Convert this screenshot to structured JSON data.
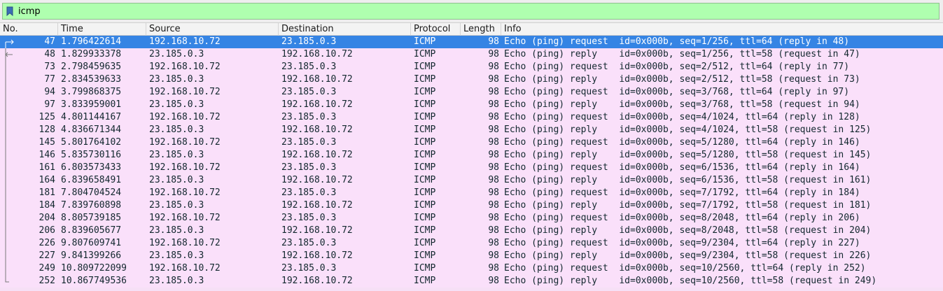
{
  "filter": {
    "value": "icmp"
  },
  "columns": [
    "No.",
    "Time",
    "Source",
    "Destination",
    "Protocol",
    "Length",
    "Info"
  ],
  "colors": {
    "row_bg": "#fae0fa",
    "selected_bg": "#3584e4",
    "filter_bg": "#afffaf"
  },
  "packets": [
    {
      "no": "47",
      "time": "1.796422614",
      "src": "192.168.10.72",
      "dst": "23.185.0.3",
      "proto": "ICMP",
      "len": "98",
      "info": "Echo (ping) request  id=0x000b, seq=1/256, ttl=64 (reply in 48)",
      "selected": true,
      "rel": "request"
    },
    {
      "no": "48",
      "time": "1.829933378",
      "src": "23.185.0.3",
      "dst": "192.168.10.72",
      "proto": "ICMP",
      "len": "98",
      "info": "Echo (ping) reply    id=0x000b, seq=1/256, ttl=58 (request in 47)",
      "selected": false,
      "rel": "reply"
    },
    {
      "no": "73",
      "time": "2.798459635",
      "src": "192.168.10.72",
      "dst": "23.185.0.3",
      "proto": "ICMP",
      "len": "98",
      "info": "Echo (ping) request  id=0x000b, seq=2/512, ttl=64 (reply in 77)",
      "selected": false,
      "rel": "line"
    },
    {
      "no": "77",
      "time": "2.834539633",
      "src": "23.185.0.3",
      "dst": "192.168.10.72",
      "proto": "ICMP",
      "len": "98",
      "info": "Echo (ping) reply    id=0x000b, seq=2/512, ttl=58 (request in 73)",
      "selected": false,
      "rel": "line"
    },
    {
      "no": "94",
      "time": "3.799868375",
      "src": "192.168.10.72",
      "dst": "23.185.0.3",
      "proto": "ICMP",
      "len": "98",
      "info": "Echo (ping) request  id=0x000b, seq=3/768, ttl=64 (reply in 97)",
      "selected": false,
      "rel": "line"
    },
    {
      "no": "97",
      "time": "3.833959001",
      "src": "23.185.0.3",
      "dst": "192.168.10.72",
      "proto": "ICMP",
      "len": "98",
      "info": "Echo (ping) reply    id=0x000b, seq=3/768, ttl=58 (request in 94)",
      "selected": false,
      "rel": "line"
    },
    {
      "no": "125",
      "time": "4.801144167",
      "src": "192.168.10.72",
      "dst": "23.185.0.3",
      "proto": "ICMP",
      "len": "98",
      "info": "Echo (ping) request  id=0x000b, seq=4/1024, ttl=64 (reply in 128)",
      "selected": false,
      "rel": "line"
    },
    {
      "no": "128",
      "time": "4.836671344",
      "src": "23.185.0.3",
      "dst": "192.168.10.72",
      "proto": "ICMP",
      "len": "98",
      "info": "Echo (ping) reply    id=0x000b, seq=4/1024, ttl=58 (request in 125)",
      "selected": false,
      "rel": "line"
    },
    {
      "no": "145",
      "time": "5.801764102",
      "src": "192.168.10.72",
      "dst": "23.185.0.3",
      "proto": "ICMP",
      "len": "98",
      "info": "Echo (ping) request  id=0x000b, seq=5/1280, ttl=64 (reply in 146)",
      "selected": false,
      "rel": "line"
    },
    {
      "no": "146",
      "time": "5.835730116",
      "src": "23.185.0.3",
      "dst": "192.168.10.72",
      "proto": "ICMP",
      "len": "98",
      "info": "Echo (ping) reply    id=0x000b, seq=5/1280, ttl=58 (request in 145)",
      "selected": false,
      "rel": "line"
    },
    {
      "no": "161",
      "time": "6.803573433",
      "src": "192.168.10.72",
      "dst": "23.185.0.3",
      "proto": "ICMP",
      "len": "98",
      "info": "Echo (ping) request  id=0x000b, seq=6/1536, ttl=64 (reply in 164)",
      "selected": false,
      "rel": "line"
    },
    {
      "no": "164",
      "time": "6.839658491",
      "src": "23.185.0.3",
      "dst": "192.168.10.72",
      "proto": "ICMP",
      "len": "98",
      "info": "Echo (ping) reply    id=0x000b, seq=6/1536, ttl=58 (request in 161)",
      "selected": false,
      "rel": "line"
    },
    {
      "no": "181",
      "time": "7.804704524",
      "src": "192.168.10.72",
      "dst": "23.185.0.3",
      "proto": "ICMP",
      "len": "98",
      "info": "Echo (ping) request  id=0x000b, seq=7/1792, ttl=64 (reply in 184)",
      "selected": false,
      "rel": "line"
    },
    {
      "no": "184",
      "time": "7.839760898",
      "src": "23.185.0.3",
      "dst": "192.168.10.72",
      "proto": "ICMP",
      "len": "98",
      "info": "Echo (ping) reply    id=0x000b, seq=7/1792, ttl=58 (request in 181)",
      "selected": false,
      "rel": "line"
    },
    {
      "no": "204",
      "time": "8.805739185",
      "src": "192.168.10.72",
      "dst": "23.185.0.3",
      "proto": "ICMP",
      "len": "98",
      "info": "Echo (ping) request  id=0x000b, seq=8/2048, ttl=64 (reply in 206)",
      "selected": false,
      "rel": "line"
    },
    {
      "no": "206",
      "time": "8.839605677",
      "src": "23.185.0.3",
      "dst": "192.168.10.72",
      "proto": "ICMP",
      "len": "98",
      "info": "Echo (ping) reply    id=0x000b, seq=8/2048, ttl=58 (request in 204)",
      "selected": false,
      "rel": "line"
    },
    {
      "no": "226",
      "time": "9.807609741",
      "src": "192.168.10.72",
      "dst": "23.185.0.3",
      "proto": "ICMP",
      "len": "98",
      "info": "Echo (ping) request  id=0x000b, seq=9/2304, ttl=64 (reply in 227)",
      "selected": false,
      "rel": "line"
    },
    {
      "no": "227",
      "time": "9.841399266",
      "src": "23.185.0.3",
      "dst": "192.168.10.72",
      "proto": "ICMP",
      "len": "98",
      "info": "Echo (ping) reply    id=0x000b, seq=9/2304, ttl=58 (request in 226)",
      "selected": false,
      "rel": "line"
    },
    {
      "no": "249",
      "time": "10.809722099",
      "src": "192.168.10.72",
      "dst": "23.185.0.3",
      "proto": "ICMP",
      "len": "98",
      "info": "Echo (ping) request  id=0x000b, seq=10/2560, ttl=64 (reply in 252)",
      "selected": false,
      "rel": "line"
    },
    {
      "no": "252",
      "time": "10.867749536",
      "src": "23.185.0.3",
      "dst": "192.168.10.72",
      "proto": "ICMP",
      "len": "98",
      "info": "Echo (ping) reply    id=0x000b, seq=10/2560, ttl=58 (request in 249)",
      "selected": false,
      "rel": "line-end"
    }
  ]
}
